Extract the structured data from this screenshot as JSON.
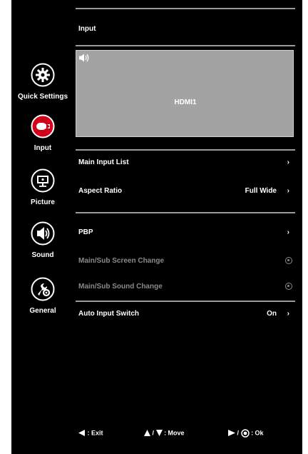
{
  "sidebar": {
    "items": [
      {
        "label": "Quick Settings",
        "icon": "gear-icon",
        "selected": false
      },
      {
        "label": "Input",
        "icon": "input-plug-icon",
        "selected": true
      },
      {
        "label": "Picture",
        "icon": "monitor-icon",
        "selected": false
      },
      {
        "label": "Sound",
        "icon": "speaker-icon",
        "selected": false
      },
      {
        "label": "General",
        "icon": "wrench-gear-icon",
        "selected": false
      }
    ]
  },
  "header": {
    "title": "Input"
  },
  "preview": {
    "source": "HDMI1",
    "sound_icon": "speaker-icon"
  },
  "menu": {
    "main_input_list": {
      "label": "Main Input List",
      "arrow": "›"
    },
    "aspect_ratio": {
      "label": "Aspect Ratio",
      "value": "Full Wide",
      "arrow": "›"
    },
    "pbp": {
      "label": "PBP",
      "arrow": "›"
    },
    "screen_change": {
      "label": "Main/Sub Screen Change",
      "enabled": false
    },
    "sound_change": {
      "label": "Main/Sub Sound Change",
      "enabled": false
    },
    "auto_input_switch": {
      "label": "Auto Input Switch",
      "value": "On",
      "arrow": "›"
    }
  },
  "footer": {
    "exit": ": Exit",
    "move_sep": "/",
    "move": ": Move",
    "ok_sep": "/",
    "ok": ": Ok"
  },
  "colors": {
    "background": "#000000",
    "accent_red": "#d0021b",
    "disabled_text": "#8a8a8a",
    "preview_bg": "#a3a3a3"
  }
}
